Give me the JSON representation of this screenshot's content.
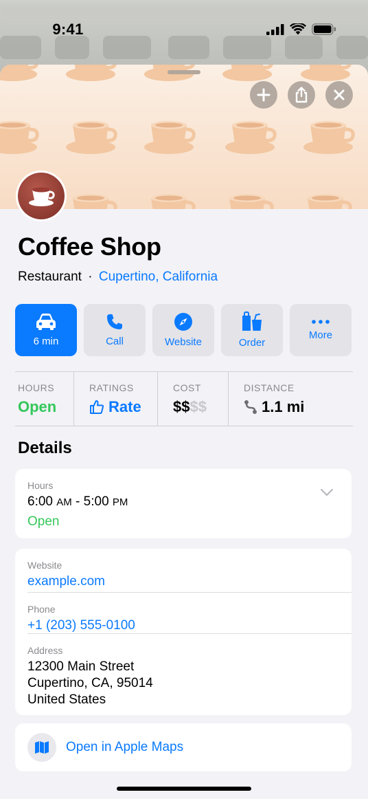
{
  "status_bar": {
    "time": "9:41"
  },
  "header": {
    "add_icon": "plus-icon",
    "share_icon": "share-icon",
    "close_icon": "close-icon",
    "theme_color": "#f8dcc4"
  },
  "place": {
    "name": "Coffee Shop",
    "category": "Restaurant",
    "separator": "·",
    "location": "Cupertino, California"
  },
  "actions": [
    {
      "label": "6 min",
      "icon": "car-icon"
    },
    {
      "label": "Call",
      "icon": "phone-icon"
    },
    {
      "label": "Website",
      "icon": "compass-icon"
    },
    {
      "label": "Order",
      "icon": "bag-icon"
    },
    {
      "label": "More",
      "icon": "ellipsis-icon"
    }
  ],
  "stats": {
    "hours": {
      "label": "HOURS",
      "value": "Open"
    },
    "ratings": {
      "label": "RATINGS",
      "value": "Rate"
    },
    "cost": {
      "label": "COST",
      "value_active": "$$",
      "value_inactive": "$$"
    },
    "distance": {
      "label": "DISTANCE",
      "value": "1.1 mi"
    }
  },
  "details": {
    "title": "Details",
    "hours": {
      "label": "Hours",
      "open_time": "6:00",
      "open_period": "AM",
      "dash": "-",
      "close_time": "5:00",
      "close_period": "PM",
      "status": "Open"
    },
    "website": {
      "label": "Website",
      "value": "example.com"
    },
    "phone": {
      "label": "Phone",
      "value": "+1 (203) 555-0100"
    },
    "address": {
      "label": "Address",
      "line1": "12300 Main Street",
      "line2": "Cupertino, CA, 95014",
      "line3": "United States"
    },
    "open_in_maps": "Open in Apple Maps"
  },
  "colors": {
    "accent": "#0a7aff",
    "open_green": "#34c759"
  }
}
